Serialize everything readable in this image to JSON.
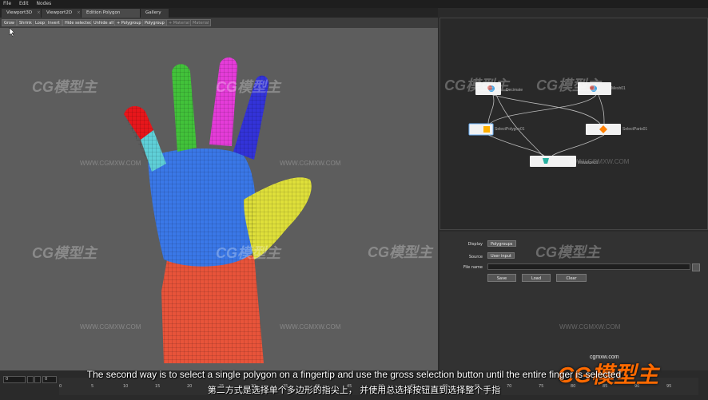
{
  "menu": [
    "File",
    "Edit",
    "Nodes"
  ],
  "tabs": [
    {
      "label": "Viewport3D"
    },
    {
      "label": "Viewport2D"
    },
    {
      "label": "Edition Polygon Selection"
    },
    {
      "label": "Gallery"
    }
  ],
  "toolbar": [
    "Grow",
    "Shrink",
    "Loop",
    "Invert",
    "Hide selected",
    "Unhide all",
    "+ Polygroup",
    "Polygroup",
    "+ Material",
    "Material"
  ],
  "nodes": [
    {
      "label": "Decimate"
    },
    {
      "label": "Mesh01"
    },
    {
      "label": "SelectPolygon01"
    },
    {
      "label": "SelectParts01"
    },
    {
      "label": "Visualize01"
    }
  ],
  "props": {
    "display_label": "Display",
    "display_value": "Polygroups",
    "source_label": "Source",
    "source_value": "User input",
    "filename_label": "File name",
    "filename_value": "",
    "save": "Save",
    "load": "Load",
    "clear": "Clear"
  },
  "timeline": {
    "frame": "0",
    "end": "0",
    "ticks": [
      "0",
      "5",
      "10",
      "15",
      "20",
      "25",
      "30",
      "35",
      "40",
      "45",
      "50",
      "55",
      "60",
      "65",
      "70",
      "75",
      "80",
      "85",
      "90",
      "95"
    ]
  },
  "subtitles": {
    "en": "The second way is to select a single polygon on a fingertip and use the gross selection button until the entire finger is selected",
    "cn": "第二方式是选择单个多边形的指尖上， 并使用总选择按钮直到选择整个手指"
  },
  "watermark": {
    "logo": "CG模型主",
    "url": "WWW.CGMXW.COM",
    "brand": "CG模型主",
    "brand_url": "cgmxw.com"
  },
  "colors": {
    "finger_red": "#e8161b",
    "finger_cyan": "#5fd0d8",
    "finger_green": "#42c23a",
    "finger_magenta": "#e53cd9",
    "finger_blue": "#3333d9",
    "palm_blue": "#3a78e8",
    "thumb_yellow": "#dfe03a",
    "wrist_red": "#e8543a",
    "brand_orange": "#ff6a00"
  }
}
